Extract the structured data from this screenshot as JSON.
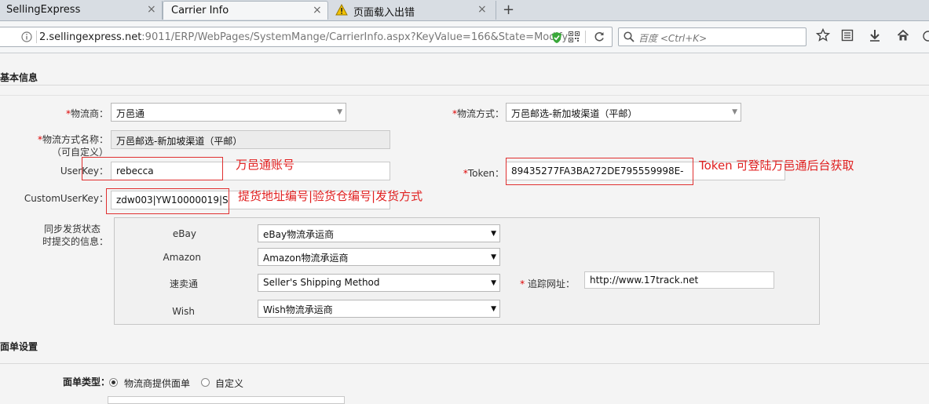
{
  "browser": {
    "tabs": [
      {
        "label": "SellingExpress",
        "close": "×"
      },
      {
        "label": "Carrier Info",
        "close": "×"
      },
      {
        "label": "页面载入出错",
        "close": "×"
      }
    ],
    "new_tab": "+",
    "url_host": "2.sellingexpress.net",
    "url_rest": ":9011/ERP/WebPages/SystemMange/CarrierInfo.aspx?KeyValue=166&State=Modify",
    "search_placeholder": "百度 <Ctrl+K>"
  },
  "basic": {
    "section_title": "基本信息",
    "carrier_label": "物流商：",
    "carrier_value": "万邑通",
    "method_label": "物流方式：",
    "method_value": "万邑邮选-新加坡渠道（平邮）",
    "method_name_label_1": "物流方式名称：",
    "method_name_label_2": "（可自定义）",
    "method_name_value": "万邑邮选-新加坡渠道（平邮）",
    "userkey_label": "UserKey：",
    "userkey_value": "rebecca",
    "token_label": "Token：",
    "token_value": "89435277FA3BA272DE795559998E-",
    "customuserkey_label": "CustomUserKey：",
    "customuserkey_value": "zdw003|YW10000019|S",
    "required_mark": "*"
  },
  "annotations": {
    "userkey_note": "万邑通账号",
    "token_note": "Token 可登陆万邑通后台获取",
    "customuserkey_note": "提货地址编号|验货仓编号|发货方式"
  },
  "sync": {
    "label_1": "同步发货状态",
    "label_2": "时提交的信息：",
    "rows": [
      {
        "platform": "eBay",
        "value": "eBay物流承运商"
      },
      {
        "platform": "Amazon",
        "value": "Amazon物流承运商"
      },
      {
        "platform": "速卖通",
        "value": "Seller's Shipping Method"
      },
      {
        "platform": "Wish",
        "value": "Wish物流承运商"
      }
    ],
    "tracking_label": "追踪网址：",
    "tracking_value": "http://www.17track.net"
  },
  "label_settings": {
    "section_title": "面单设置",
    "type_label": "面单类型：",
    "options": [
      {
        "label": "物流商提供面单",
        "selected": true
      },
      {
        "label": "自定义",
        "selected": false
      }
    ]
  },
  "colors": {
    "annotation_red": "#e02020",
    "required_red": "#dd0000"
  }
}
